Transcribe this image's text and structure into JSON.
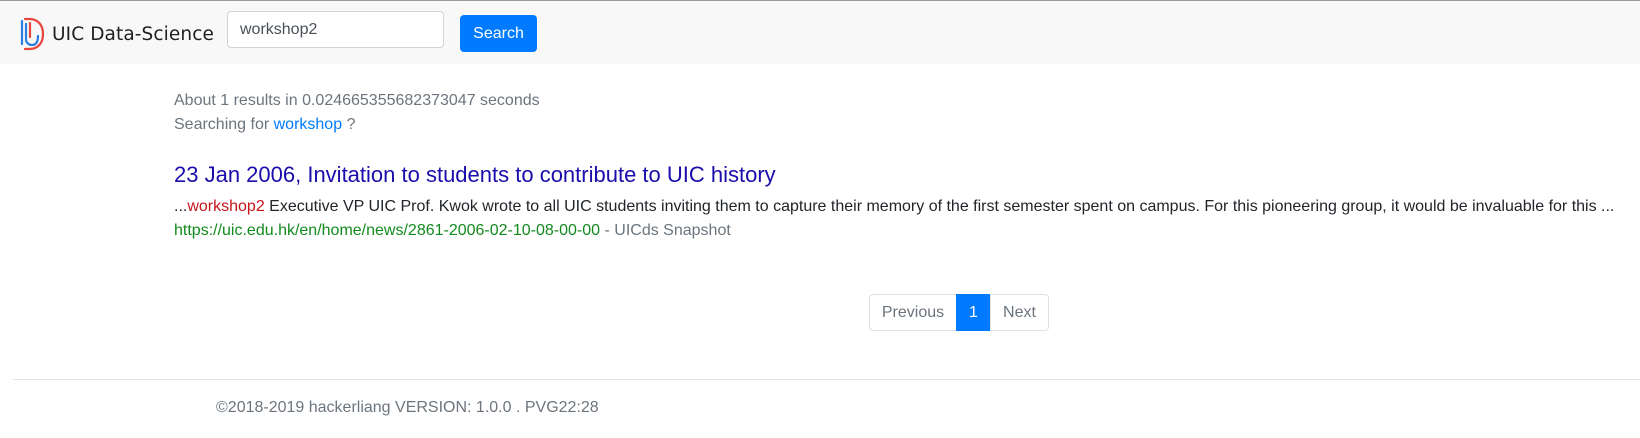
{
  "brand": {
    "name": "UIC Data-Science",
    "logo_colors": {
      "blue": "#2b7de0",
      "red": "#e8463c"
    }
  },
  "search": {
    "query": "workshop2",
    "button_label": "Search"
  },
  "results_meta": {
    "summary": "About 1 results in 0.024665355682373047 seconds",
    "suggestion_prefix": "Searching for",
    "suggestion_term": "workshop",
    "suggestion_suffix": "?"
  },
  "results": [
    {
      "title": "23 Jan 2006, Invitation to students to contribute to UIC history",
      "snippet_prefix": "...",
      "snippet_highlight": "workshop2",
      "snippet_text": " Executive VP UIC Prof. Kwok wrote to all UIC students inviting them to capture their memory of the first semester spent on campus. For this pioneering group, it would be invaluable for this ...",
      "url": "https://uic.edu.hk/en/home/news/2861-2006-02-10-08-00-00",
      "separator": " - ",
      "snapshot_label": "UICds Snapshot"
    }
  ],
  "pagination": {
    "previous_label": "Previous",
    "current_page": "1",
    "next_label": "Next"
  },
  "footer": {
    "text": "©2018-2019 hackerliang VERSION: 1.0.0 . PVG22:28"
  },
  "colors": {
    "accent": "#007bff",
    "title_link": "#1a0dab",
    "highlight": "#c5161c",
    "url": "#138a1e",
    "muted": "#6c757d"
  }
}
